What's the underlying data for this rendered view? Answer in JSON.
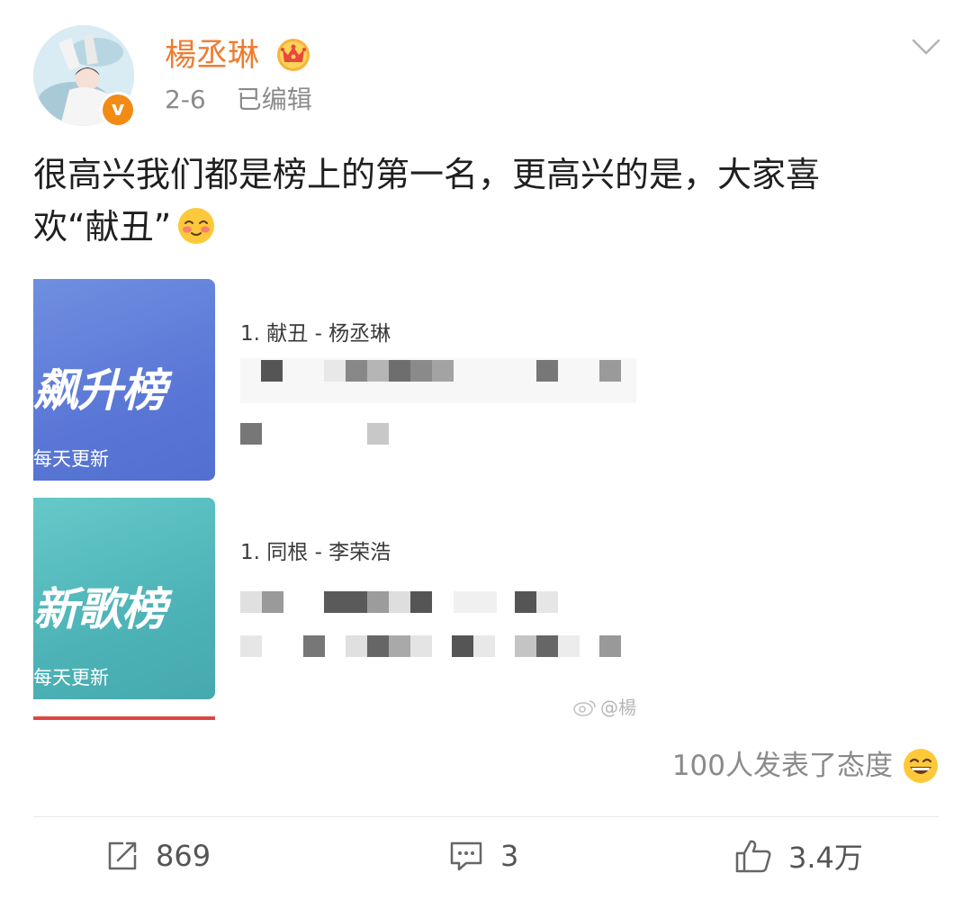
{
  "post": {
    "author": "楊丞琳",
    "date": "2-6",
    "edited_label": "已编辑",
    "text_line1": "很高兴我们都是榜上的第一名，更高兴的是，大家喜",
    "text_line2": "欢“献丑”"
  },
  "cards": [
    {
      "image_title": "飙升榜",
      "image_subtitle": "每天更新",
      "first_item": "1. 献丑 - 杨丞琳",
      "accent": "#5a77d6"
    },
    {
      "image_title": "新歌榜",
      "image_subtitle": "每天更新",
      "first_item": "1. 同根 - 李荣浩",
      "accent": "#4db3b7"
    }
  ],
  "watermark": "@楊",
  "reactions_label": "100人发表了态度",
  "actions": {
    "repost_count": "869",
    "comment_count": "3",
    "like_count": "3.4万"
  },
  "colors": {
    "username": "#ee7c2f",
    "verified_badge": "#f28b16",
    "muted_text": "#8b8b8b"
  },
  "icons": {
    "verified": "verified-v-badge-icon",
    "member": "crown-icon",
    "menu": "chevron-down-icon",
    "repost": "repost-icon",
    "comment": "comment-icon",
    "like": "thumbs-up-icon"
  }
}
